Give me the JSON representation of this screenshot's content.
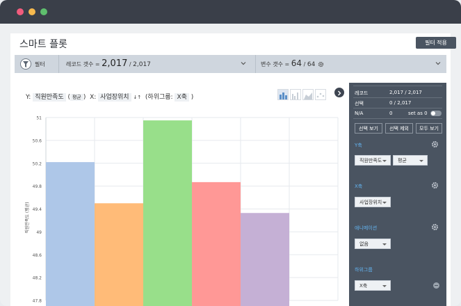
{
  "app": {
    "title": "스마트 플롯",
    "apply_button": "필터 적용"
  },
  "filterbar": {
    "filter_label": "필터",
    "records_label": "레코드 갯수 = ",
    "records_count": "2,017",
    "records_sep": " / ",
    "records_total": "2,017",
    "vars_label": "변수 갯수 = ",
    "vars_count": "64",
    "vars_sep": " / ",
    "vars_total": "64"
  },
  "axis_config": {
    "y_prefix": "Y: ",
    "y_var": "직원만족도",
    "y_agg": "평균",
    "x_prefix": "X: ",
    "x_var": "사업장위치",
    "sort_icon_text": "↓↑",
    "group_prefix": "(하위그룹: ",
    "group_var": "X축",
    "group_suffix": ")"
  },
  "chart_data": {
    "type": "bar",
    "ylabel": "직원만족도 (평균)",
    "ylim": [
      47.8,
      51
    ],
    "yticks": [
      "51",
      "50.6",
      "50.2",
      "49.8",
      "49.4",
      "49",
      "48.6",
      "48.2",
      "47.8"
    ],
    "values": [
      50.22,
      49.5,
      50.95,
      49.87,
      49.33
    ],
    "colors": [
      "#aec7e8",
      "#ffbb78",
      "#98df8a",
      "#ff9896",
      "#c5b0d5"
    ]
  },
  "sidepanel": {
    "record_label": "레코드",
    "record_value": "2,017 / 2,017",
    "selected_label": "선택",
    "selected_value": "0 / 2,017",
    "na_label": "N/A",
    "na_value": "0",
    "set_as_zero": "set as 0",
    "btn_view_selected": "선택 보기",
    "btn_clear_selected": "선택 제외",
    "btn_view_all": "모두 보기",
    "y_section": "Y축",
    "y_var": "직원만족도",
    "y_agg": "평균",
    "x_section": "X축",
    "x_var": "사업장위치",
    "anim_section": "애니메이션",
    "anim_value": "없음",
    "group_section": "하위그룹",
    "group_value": "X축"
  },
  "colors": {
    "sidepanel_bg": "#4a5461",
    "accent_blue": "#63b3f0",
    "titlebar": "#3a3f49"
  }
}
